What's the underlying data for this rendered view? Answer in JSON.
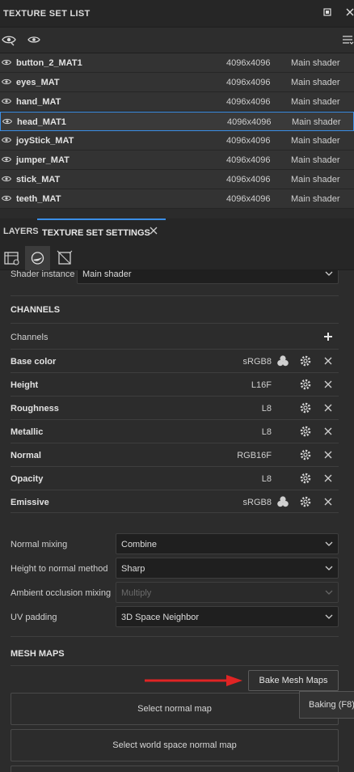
{
  "panel": {
    "title": "TEXTURE SET LIST"
  },
  "texture_sets": [
    {
      "name": "button_2_MAT1",
      "resolution": "4096x4096",
      "shader": "Main shader"
    },
    {
      "name": "eyes_MAT",
      "resolution": "4096x4096",
      "shader": "Main shader"
    },
    {
      "name": "hand_MAT",
      "resolution": "4096x4096",
      "shader": "Main shader"
    },
    {
      "name": "head_MAT1",
      "resolution": "4096x4096",
      "shader": "Main shader",
      "selected": true
    },
    {
      "name": "joyStick_MAT",
      "resolution": "4096x4096",
      "shader": "Main shader"
    },
    {
      "name": "jumper_MAT",
      "resolution": "4096x4096",
      "shader": "Main shader"
    },
    {
      "name": "stick_MAT",
      "resolution": "4096x4096",
      "shader": "Main shader"
    },
    {
      "name": "teeth_MAT",
      "resolution": "4096x4096",
      "shader": "Main shader"
    }
  ],
  "tabs": {
    "layers": "LAYERS",
    "texture_set_settings": "TEXTURE SET SETTINGS"
  },
  "shader_instance": {
    "label": "Shader instance",
    "value": "Main shader"
  },
  "channels_section": {
    "title": "CHANNELS",
    "list_label": "Channels"
  },
  "channels": [
    {
      "name": "Base color",
      "format": "sRGB8",
      "has_uv_icon": true
    },
    {
      "name": "Height",
      "format": "L16F",
      "has_uv_icon": false
    },
    {
      "name": "Roughness",
      "format": "L8",
      "has_uv_icon": false
    },
    {
      "name": "Metallic",
      "format": "L8",
      "has_uv_icon": false
    },
    {
      "name": "Normal",
      "format": "RGB16F",
      "has_uv_icon": false
    },
    {
      "name": "Opacity",
      "format": "L8",
      "has_uv_icon": false
    },
    {
      "name": "Emissive",
      "format": "sRGB8",
      "has_uv_icon": true
    }
  ],
  "settings": {
    "normal_mixing": {
      "label": "Normal mixing",
      "value": "Combine"
    },
    "height_to_normal": {
      "label": "Height to normal method",
      "value": "Sharp"
    },
    "ao_mixing": {
      "label": "Ambient occlusion mixing",
      "value": "Multiply"
    },
    "uv_padding": {
      "label": "UV padding",
      "value": "3D Space Neighbor"
    }
  },
  "mesh_maps": {
    "title": "MESH MAPS",
    "bake_button": "Bake Mesh Maps",
    "tooltip": "Baking (F8)",
    "select_normal": "Select normal map",
    "select_world_normal": "Select world space normal map"
  },
  "colors": {
    "accent": "#3a8ee6",
    "arrow": "#e02424"
  }
}
